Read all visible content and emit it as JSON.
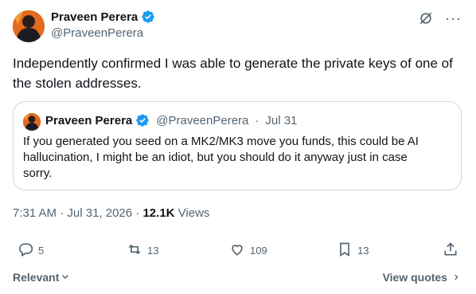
{
  "author": {
    "name": "Praveen Perera",
    "handle": "@PraveenPerera"
  },
  "tweet": {
    "text": "Independently confirmed I was able to generate the private keys of one of the stolen addresses."
  },
  "quote": {
    "name": "Praveen Perera",
    "handle": "@PraveenPerera",
    "separator": "·",
    "date": "Jul 31",
    "text": "If you generated you seed on a MK2/MK3 move you funds, this could be AI hallucination, I might be an idiot, but you should do it anyway just in case sorry."
  },
  "meta": {
    "time": "7:31 AM",
    "separator": "·",
    "date": "Jul 31, 2026",
    "separator2": "·",
    "views_count": "12.1K",
    "views_label": "Views"
  },
  "actions": {
    "replies": "5",
    "reposts": "13",
    "likes": "109",
    "bookmarks": "13"
  },
  "footer": {
    "sort_label": "Relevant",
    "view_quotes": "View quotes"
  },
  "icons": {
    "verified": "verified-badge-icon",
    "grok": "grok-icon",
    "more": "more-icon",
    "reply": "reply-icon",
    "repost": "repost-icon",
    "like": "like-icon",
    "bookmark": "bookmark-icon",
    "share": "share-icon"
  },
  "colors": {
    "verified": "#1d9bf0",
    "text_secondary": "#536471",
    "border": "#cfd9de"
  }
}
